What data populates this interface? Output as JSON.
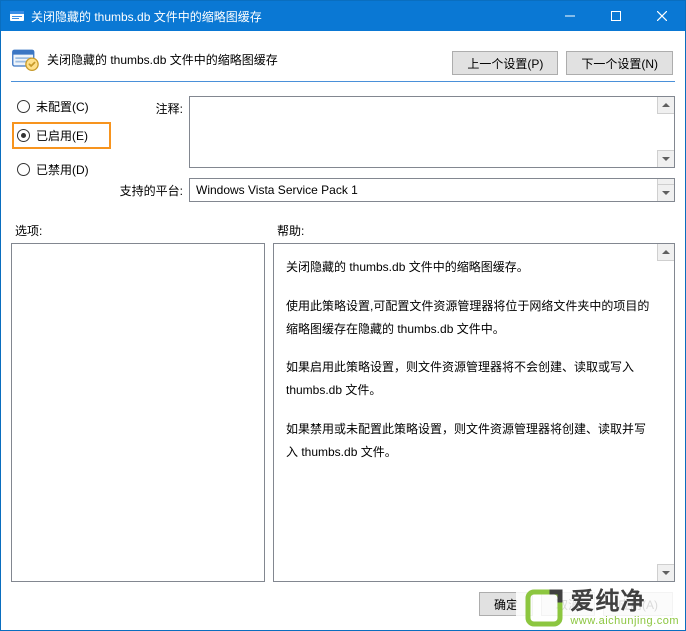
{
  "titlebar": {
    "title": "关闭隐藏的 thumbs.db 文件中的缩略图缓存"
  },
  "header": {
    "policy_title": "关闭隐藏的 thumbs.db 文件中的缩略图缓存",
    "prev_btn": "上一个设置(P)",
    "next_btn": "下一个设置(N)"
  },
  "radios": {
    "not_configured": "未配置(C)",
    "enabled": "已启用(E)",
    "disabled": "已禁用(D)",
    "selected": "enabled"
  },
  "fields": {
    "comment_label": "注释:",
    "comment_value": "",
    "platform_label": "支持的平台:",
    "platform_value": "Windows Vista Service Pack 1"
  },
  "section_labels": {
    "options": "选项:",
    "help": "帮助:"
  },
  "help_text": {
    "p1": "关闭隐藏的 thumbs.db 文件中的缩略图缓存。",
    "p2": "使用此策略设置,可配置文件资源管理器将位于网络文件夹中的项目的缩略图缓存在隐藏的 thumbs.db 文件中。",
    "p3": "如果启用此策略设置，则文件资源管理器将不会创建、读取或写入 thumbs.db 文件。",
    "p4": "如果禁用或未配置此策略设置，则文件资源管理器将创建、读取并写入 thumbs.db 文件。"
  },
  "footer": {
    "ok": "确定",
    "cancel": "取消",
    "apply": "应用(A)"
  },
  "watermark": {
    "cn": "爱纯净",
    "en": "www.aichunjing.com"
  }
}
